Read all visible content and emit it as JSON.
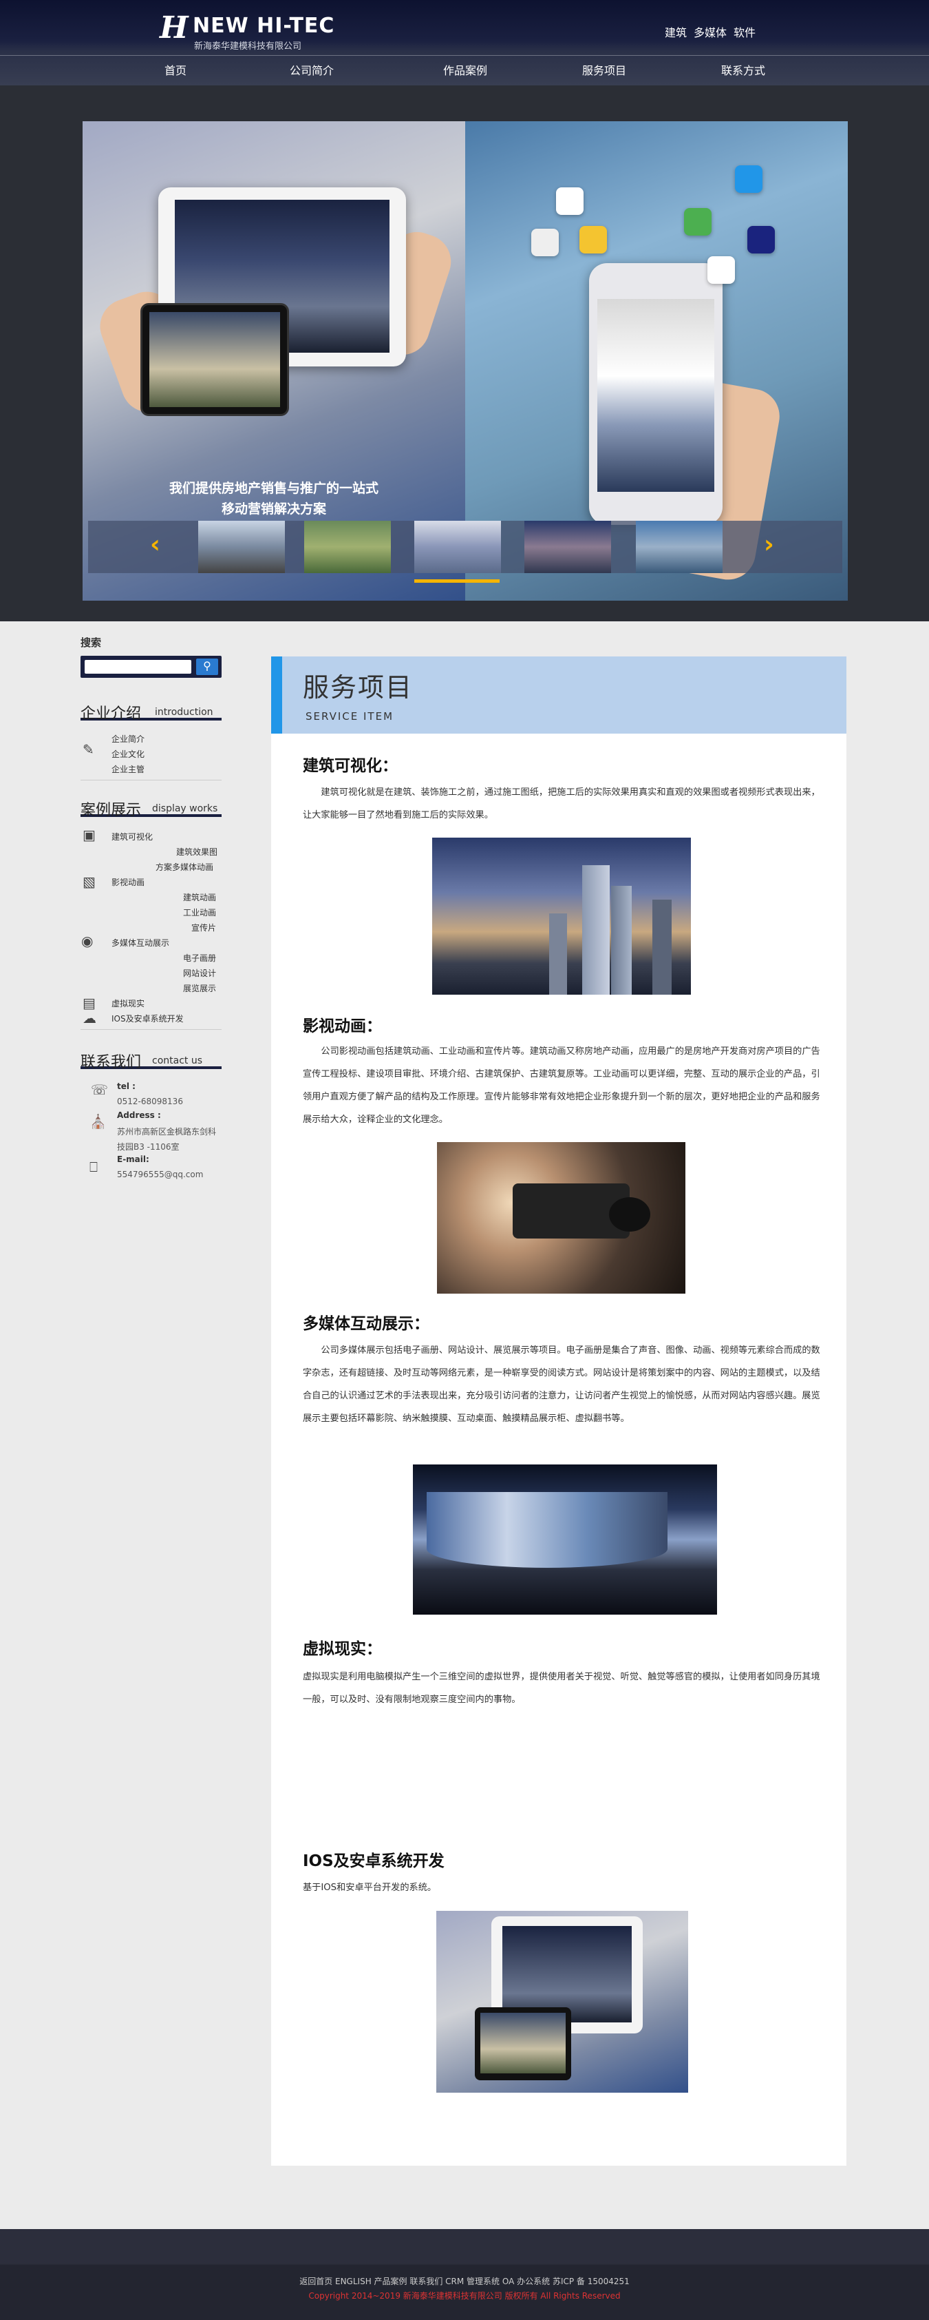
{
  "header": {
    "logo_brand": "NEW HI-TEC",
    "logo_mark": "H",
    "logo_sub": "新海泰华建模科技有限公司",
    "toplinks": [
      "建筑",
      "多媒体",
      "软件"
    ]
  },
  "nav": {
    "items": [
      "首页",
      "公司简介",
      "作品案例",
      "服务项目",
      "联系方式"
    ]
  },
  "banner": {
    "slogan_line1": "我们提供房地产销售与推广的一站式",
    "slogan_line2": "移动营销解决方案",
    "prev_arrow": "‹",
    "next_arrow": "›",
    "active_thumb": 3
  },
  "sidebar": {
    "search_title": "搜索",
    "search_placeholder": "",
    "search_icon": "search-icon",
    "intro": {
      "cn": "企业介绍",
      "en": "introduction",
      "items": [
        "企业简介",
        "企业文化",
        "企业主管"
      ]
    },
    "cases": {
      "cn": "案例展示",
      "en": "display works",
      "groups": [
        {
          "label": "建筑可视化",
          "subs": [
            "建筑效果图",
            "方案多媒体动画"
          ]
        },
        {
          "label": "影视动画",
          "subs": [
            "建筑动画",
            "工业动画",
            "宣传片"
          ]
        },
        {
          "label": "多媒体互动展示",
          "subs": [
            "电子画册",
            "网站设计",
            "展览展示"
          ]
        },
        {
          "label": "虚拟现实",
          "subs": []
        },
        {
          "label": "IOS及安卓系统开发",
          "subs": []
        }
      ]
    },
    "contact": {
      "cn": "联系我们",
      "en": "contact us",
      "tel_label": "tel :",
      "tel": "0512-68098136",
      "addr_label": "Address :",
      "addr_line1": "苏州市高新区金枫路东剑科",
      "addr_line2": "技园B3 -1106室",
      "email_label": "E-mail:",
      "email": "554796555@qq.com"
    }
  },
  "main": {
    "title_cn": "服务项目",
    "title_en": "SERVICE ITEM",
    "sections": [
      {
        "heading": "建筑可视化：",
        "text": "建筑可视化就是在建筑、装饰施工之前，通过施工图纸，把施工后的实际效果用真实和直观的效果图或者视频形式表现出来，让大家能够一目了然地看到施工后的实际效果。"
      },
      {
        "heading": "影视动画：",
        "text": "公司影视动画包括建筑动画、工业动画和宣传片等。建筑动画又称房地产动画，应用最广的是房地产开发商对房产项目的广告宣传工程投标、建设项目审批、环境介绍、古建筑保护、古建筑复原等。工业动画可以更详细，完整、互动的展示企业的产品，引领用户直观方便了解产品的结构及工作原理。宣传片能够非常有效地把企业形象提升到一个新的层次，更好地把企业的产品和服务展示给大众，诠释企业的文化理念。"
      },
      {
        "heading": "多媒体互动展示：",
        "text": "公司多媒体展示包括电子画册、网站设计、展览展示等项目。电子画册是集合了声音、图像、动画、视频等元素综合而成的数字杂志，还有超链接、及时互动等网络元素，是一种崭享受的阅读方式。网站设计是将策划案中的内容、网站的主题模式，以及结合自己的认识通过艺术的手法表现出来，充分吸引访问者的注意力，让访问者产生视觉上的愉悦感，从而对网站内容感兴趣。展览展示主要包括环幕影院、纳米触摸膜、互动桌面、触摸精品展示柜、虚拟翻书等。"
      },
      {
        "heading": "虚拟现实：",
        "text": "虚拟现实是利用电脑模拟产生一个三维空间的虚拟世界，提供使用者关于视觉、听觉、触觉等感官的模拟，让使用者如同身历其境一般，可以及时、没有限制地观察三度空间内的事物。"
      },
      {
        "heading": "IOS及安卓系统开发",
        "text": "基于IOS和安卓平台开发的系统。"
      }
    ]
  },
  "footer": {
    "links": "返回首页  ENGLISH  产品案例  联系我们  CRM 管理系统  OA 办公系统  苏ICP 备 15004251",
    "copyright": "Copyright 2014~2019  新海泰华建模科技有限公司 版权所有 All Rights Reserved"
  },
  "colors": {
    "header_bg": "#0d1230",
    "accent_blue": "#2196e8",
    "accent_yellow": "#f5b400",
    "service_header_bg": "#b8d0ec"
  }
}
